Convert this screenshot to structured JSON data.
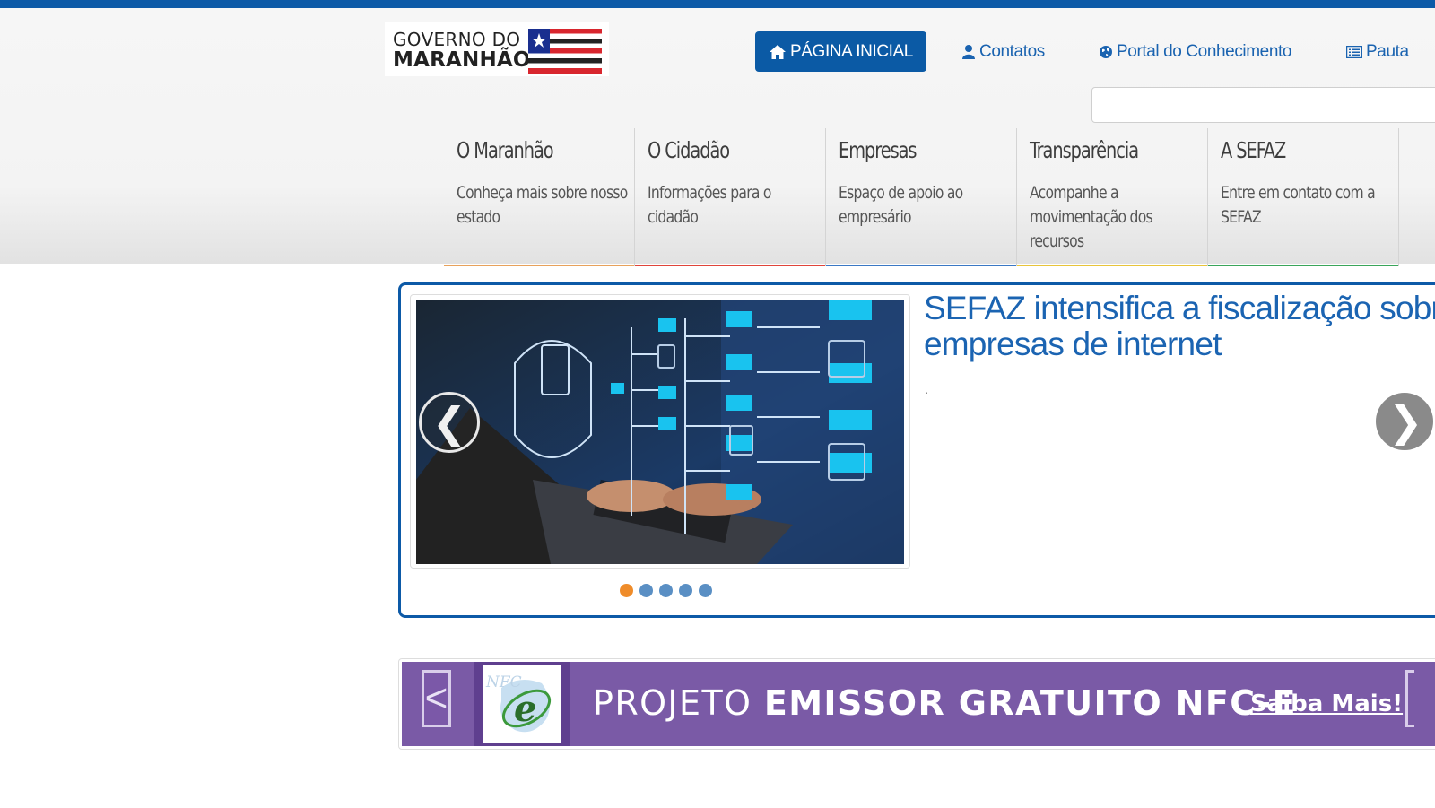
{
  "logo": {
    "line1": "GOVERNO DO",
    "line2": "MARANHÃO"
  },
  "nav": {
    "home": "PÁGINA INICIAL",
    "contatos": "Contatos",
    "portal": "Portal do Conhecimento",
    "pauta": "Pauta"
  },
  "search": {
    "placeholder": ""
  },
  "menu": [
    {
      "title": "O Maranhão",
      "desc": "Conheça mais sobre nosso estado",
      "color": "#e8a25c"
    },
    {
      "title": "O Cidadão",
      "desc": "Informações para o cidadão",
      "color": "#e0443a"
    },
    {
      "title": "Empresas",
      "desc": "Espaço de apoio ao empresário",
      "color": "#3b78c4"
    },
    {
      "title": "Transparência",
      "desc": "Acompanhe a movimentação dos recursos",
      "color": "#e8c43a"
    },
    {
      "title": "A SEFAZ",
      "desc": "Entre em contato com a SEFAZ",
      "color": "#3aa55a"
    }
  ],
  "carousel": {
    "headline": "SEFAZ intensifica a fiscalização sobre empresas de internet",
    "summary": ".",
    "prev": "❮",
    "next": "❯",
    "active_index": 0,
    "slide_count": 5
  },
  "banner": {
    "prev": "<",
    "logo_text": "NFC",
    "logo_letter": "e",
    "text_normal": "PROJETO ",
    "text_bold": "EMISSOR GRATUITO NFC-E",
    "cta": "Saiba Mais!"
  },
  "colors": {
    "primary": "#0d5aa7",
    "banner": "#7a5aa6",
    "dot_active": "#ef8c2a",
    "dot": "#5a8fc4"
  }
}
